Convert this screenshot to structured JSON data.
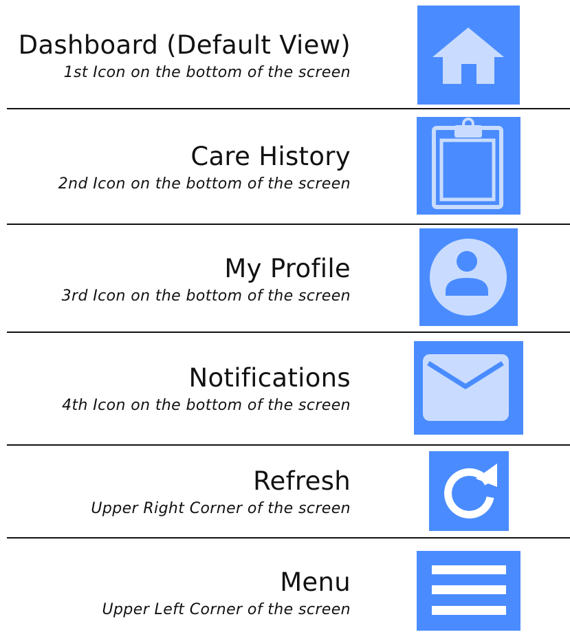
{
  "items": [
    {
      "title": "Dashboard (Default View)",
      "subtitle": "1st Icon on the bottom of the screen",
      "icon": "home-icon"
    },
    {
      "title": "Care History",
      "subtitle": "2nd Icon on the bottom of the screen",
      "icon": "clipboard-icon"
    },
    {
      "title": "My Profile",
      "subtitle": "3rd Icon on the bottom of the screen",
      "icon": "person-icon"
    },
    {
      "title": "Notifications",
      "subtitle": "4th Icon on the bottom of the screen",
      "icon": "envelope-icon"
    },
    {
      "title": "Refresh",
      "subtitle": "Upper Right Corner of the screen",
      "icon": "refresh-icon"
    },
    {
      "title": "Menu",
      "subtitle": "Upper Left Corner of the screen",
      "icon": "menu-icon"
    }
  ],
  "colors": {
    "tile": "#4a8cff",
    "glyph": "#c9dcff",
    "divider": "#111111"
  }
}
